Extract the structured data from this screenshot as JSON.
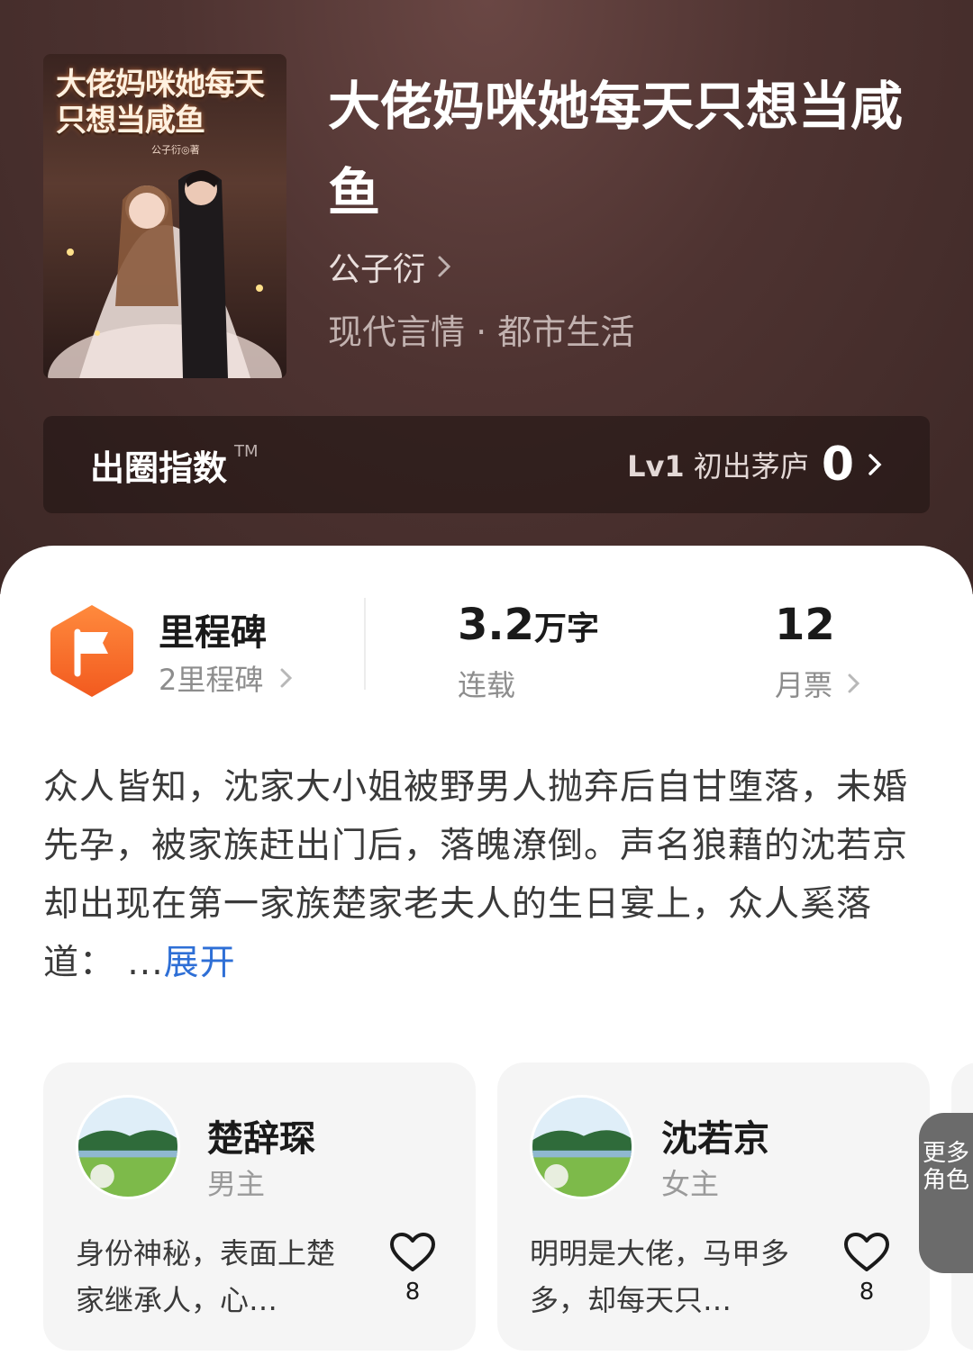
{
  "book": {
    "cover_title": "大佬妈咪她每天只想当咸鱼",
    "cover_author": "公子衍◎著",
    "title": "大佬妈咪她每天只想当咸鱼",
    "author": "公子衍",
    "genre": "现代言情 · 都市生活"
  },
  "index_bar": {
    "title": "出圈指数",
    "tm": "TM",
    "level_code": "Lv1",
    "level_name": "初出茅庐",
    "score": "0"
  },
  "stats": {
    "milestone_title": "里程碑",
    "milestone_sub": "2里程碑",
    "words_value": "3.2",
    "words_unit": "万字",
    "words_sub": "连载",
    "votes_value": "12",
    "votes_sub": "月票"
  },
  "synopsis": {
    "text": "众人皆知，沈家大小姐被野男人抛弃后自甘堕落，未婚先孕，被家族赶出门后，落魄潦倒。声名狼藉的沈若京却出现在第一家族楚家老夫人的生日宴上，众人奚落道：",
    "ellipsis": " ...",
    "expand": "展开"
  },
  "characters": [
    {
      "name": "楚辞琛",
      "role": "男主",
      "desc": "身份神秘，表面上楚家继承人，心…",
      "likes": "8"
    },
    {
      "name": "沈若京",
      "role": "女主",
      "desc": "明明是大佬，马甲多多，却每天只…",
      "likes": "8"
    }
  ],
  "more_roles": "更多角色",
  "colors": {
    "accent_orange": "#f26b2a",
    "link_blue": "#2e6fd6",
    "hero_bg": "#4e3331"
  },
  "icons": [
    "chevron-right-icon",
    "flag-icon",
    "heart-icon"
  ]
}
